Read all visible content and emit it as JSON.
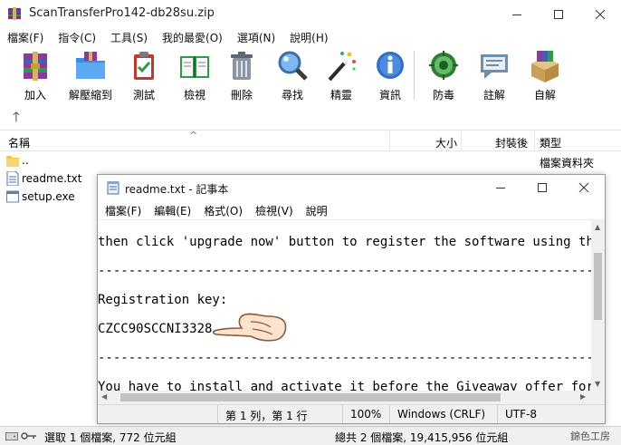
{
  "window": {
    "title": "ScanTransferPro142-db28su.zip"
  },
  "menubar": [
    "檔案(F)",
    "指令(C)",
    "工具(S)",
    "我的最愛(O)",
    "選項(N)",
    "說明(H)"
  ],
  "toolbar": [
    {
      "label": "加入",
      "icon": "add-archive-icon"
    },
    {
      "label": "解壓縮到",
      "icon": "extract-folder-icon"
    },
    {
      "label": "測試",
      "icon": "test-clipboard-icon"
    },
    {
      "label": "檢視",
      "icon": "view-book-icon"
    },
    {
      "label": "刪除",
      "icon": "trash-icon"
    },
    {
      "label": "尋找",
      "icon": "magnifier-icon"
    },
    {
      "label": "精靈",
      "icon": "wizard-wand-icon"
    },
    {
      "label": "資訊",
      "icon": "info-icon"
    },
    {
      "label": "防毒",
      "icon": "virus-scan-icon"
    },
    {
      "label": "註解",
      "icon": "comment-icon"
    },
    {
      "label": "自解",
      "icon": "sfx-box-icon"
    }
  ],
  "columns": {
    "name": "名稱",
    "size": "大小",
    "packed": "封裝後",
    "type": "類型"
  },
  "files": [
    {
      "name": "..",
      "type": "檔案資料夾",
      "icon": "folder-icon"
    },
    {
      "name": "readme.txt",
      "type": "",
      "icon": "text-file-icon"
    },
    {
      "name": "setup.exe",
      "type": "",
      "icon": "exe-file-icon"
    }
  ],
  "status": {
    "left": "選取 1 個檔案, 772 位元組",
    "right": "總共 2 個檔案, 19,415,956 位元組",
    "watermark": "錦色工房"
  },
  "notepad": {
    "title": "readme.txt - 記事本",
    "menubar": [
      "檔案(F)",
      "編輯(E)",
      "格式(O)",
      "檢視(V)",
      "說明"
    ],
    "lines": [
      "then click 'upgrade now' button to register the software using the r",
      "----------------------------------------------------------------------",
      "Registration key:",
      "CZCC90SCCNI3328",
      "----------------------------------------------------------------------",
      "You have to install and activate it before the Giveaway offer for th"
    ],
    "status": {
      "position": "第 1 列，第 1 行",
      "zoom": "100%",
      "line_ending": "Windows (CRLF)",
      "encoding": "UTF-8"
    }
  },
  "colors": {
    "accent": "#0078d7",
    "folder": "#f4c542",
    "hand": "#fbe3cf"
  }
}
